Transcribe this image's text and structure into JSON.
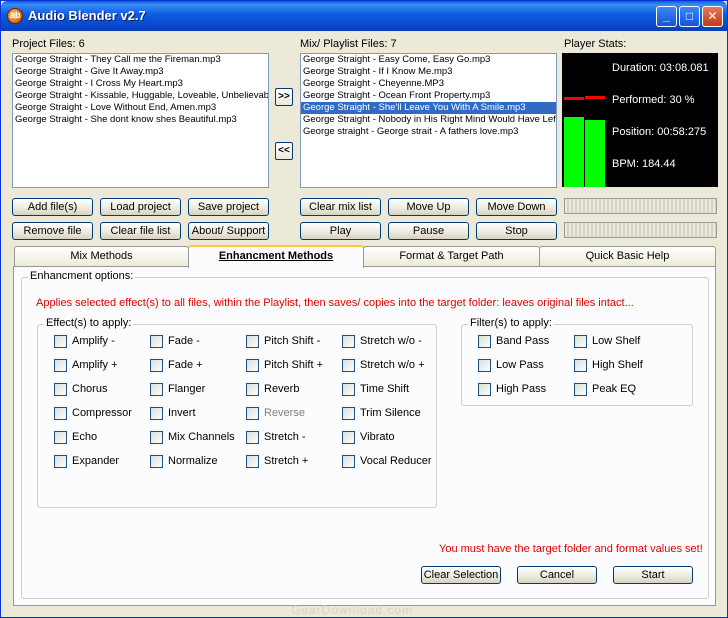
{
  "window": {
    "title": "Audio Blender v2.7",
    "icon_glyph": "ab",
    "minimize_glyph": "_",
    "maximize_glyph": "□",
    "close_glyph": "✕"
  },
  "project": {
    "label": "Project Files: 6",
    "files": [
      "George Straight - They Call me the Fireman.mp3",
      "George Straight - Give It Away.mp3",
      "George Straight - I Cross My Heart.mp3",
      "George Straight - Kissable, Huggable, Loveable, Unbelievable",
      "George Straight - Love Without End, Amen.mp3",
      "George Straight - She dont know shes Beautiful.mp3"
    ]
  },
  "move_buttons": {
    "add_to_mix": ">>",
    "remove_from_mix": "<<"
  },
  "playlist": {
    "label": "Mix/ Playlist Files: 7",
    "selected_index": 4,
    "files": [
      "George Straight - Easy Come, Easy Go.mp3",
      "George Straight - If I Know Me.mp3",
      "George Straight - Cheyenne.MP3",
      "George Straight - Ocean Front Property.mp3",
      "George Straight - She'll Leave You With A Smile.mp3",
      "George Straight - Nobody in His Right Mind Would Have Left",
      "George straight - George strait - A fathers love.mp3"
    ]
  },
  "player_stats": {
    "label": "Player Stats:",
    "duration": "Duration: 03:08.081",
    "performed": "Performed: 30 %",
    "position": "Position: 00:58:275",
    "bpm": "BPM: 184.44",
    "meter_left_level": 0.52,
    "meter_right_level": 0.5,
    "meter_left_peak": 0.67,
    "meter_right_peak": 0.68,
    "meter_color": "#00ff00",
    "peak_color": "#ff0000"
  },
  "project_buttons": {
    "add_files": "Add file(s)",
    "load_project": "Load project",
    "save_project": "Save project",
    "remove_file": "Remove file",
    "clear_file_list": "Clear file list",
    "about_support": "About/ Support"
  },
  "mix_buttons": {
    "clear_mix_list": "Clear mix list",
    "move_up": "Move Up",
    "move_down": "Move Down",
    "play": "Play",
    "pause": "Pause",
    "stop": "Stop"
  },
  "tabs": [
    {
      "label": "Mix Methods",
      "active": false
    },
    {
      "label": "Enhancment Methods",
      "active": true
    },
    {
      "label": "Format & Target Path",
      "active": false
    },
    {
      "label": "Quick Basic Help",
      "active": false
    }
  ],
  "enhancement": {
    "options_label": "Enhancment options:",
    "info_text": "Applies selected effect(s) to all files, within the Playlist, then saves/ copies into the target folder: leaves original files intact...",
    "effects_title": "Effect(s) to apply:",
    "effects_col1": [
      "Amplify -",
      "Amplify +",
      "Chorus",
      "Compressor",
      "Echo",
      "Expander"
    ],
    "effects_col2": [
      "Fade -",
      "Fade +",
      "Flanger",
      "Invert",
      "Mix Channels",
      "Normalize"
    ],
    "effects_col3": [
      "Pitch Shift -",
      "Pitch Shift +",
      "Reverb",
      "Reverse",
      "Stretch -",
      "Stretch +"
    ],
    "effects_col4": [
      "Stretch w/o -",
      "Stretch w/o +",
      "Time Shift",
      "Trim Silence",
      "Vibrato",
      "Vocal Reducer"
    ],
    "filters_title": "Filter(s) to apply:",
    "filters_col1": [
      "Band Pass",
      "Low Pass",
      "High Pass"
    ],
    "filters_col2": [
      "Low Shelf",
      "High Shelf",
      "Peak EQ"
    ],
    "warning_text": "You must have the target folder and format values set!",
    "clear_selection": "Clear Selection",
    "cancel": "Cancel",
    "start": "Start"
  },
  "watermark": "GearDownload.com"
}
